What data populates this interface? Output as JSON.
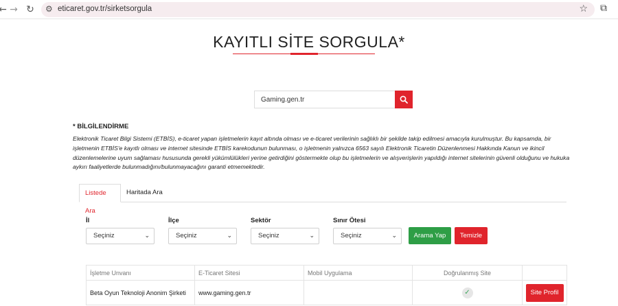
{
  "browser": {
    "url": "eticaret.gov.tr/sirketsorgula",
    "icons": {
      "back": "back-arrow-icon",
      "forward": "forward-arrow-icon",
      "reload": "reload-icon",
      "site": "site-settings-icon",
      "bookmark": "star-icon",
      "extensions": "extensions-icon"
    }
  },
  "page": {
    "title": "KAYITLI SİTE SORGULA*",
    "accent_color": "#e0242c"
  },
  "search": {
    "value": "Gaming.gen.tr",
    "button_icon": "search-icon"
  },
  "info": {
    "heading": "* BİLGİLENDİRME",
    "text": "Elektronik Ticaret Bilgi Sistemi (ETBİS), e-ticaret yapan işletmelerin kayıt altında olması ve e-ticaret verilerinin sağlıklı bir şekilde takip edilmesi amacıyla kurulmuştur. Bu kapsamda, bir işletmenin ETBİS'e kayıtlı olması ve internet sitesinde ETBİS karekodunun bulunması, o işletmenin yalnızca 6563 sayılı Elektronik Ticaretin Düzenlenmesi Hakkında Kanun ve ikincil düzenlemelerine uyum sağlaması hususunda gerekli yükümlülükleri yerine getirdiğini göstermekte olup bu işletmelerin ve alışverişlerin yapıldığı internet sitelerinin güvenli olduğunu ve hukuka aykırı faaliyetlerde bulunmadığını/bulunmayacağını garanti etmemektedir."
  },
  "tabs": [
    {
      "label": "Listede Ara",
      "active": true
    },
    {
      "label": "Haritada Ara",
      "active": false
    }
  ],
  "filters": {
    "il": {
      "label": "İl",
      "value": "Seçiniz"
    },
    "ilce": {
      "label": "İlçe",
      "value": "Seçiniz"
    },
    "sektor": {
      "label": "Sektör",
      "value": "Seçiniz"
    },
    "sinir": {
      "label": "Sınır Ötesi",
      "value": "Seçiniz"
    },
    "search_label": "Arama Yap",
    "clear_label": "Temizle",
    "search_color": "#2e9e46"
  },
  "table": {
    "headers": [
      "İşletme Unvanı",
      "E-Ticaret Sitesi",
      "Mobil Uygulama",
      "Doğrulanmış Site",
      ""
    ],
    "rows": [
      {
        "name": "Beta Oyun Teknoloji Anonim Şirketi",
        "site": "www.gaming.gen.tr",
        "mobile": "",
        "verified_icon": "check-icon",
        "profile_label": "Site Profil"
      }
    ]
  }
}
